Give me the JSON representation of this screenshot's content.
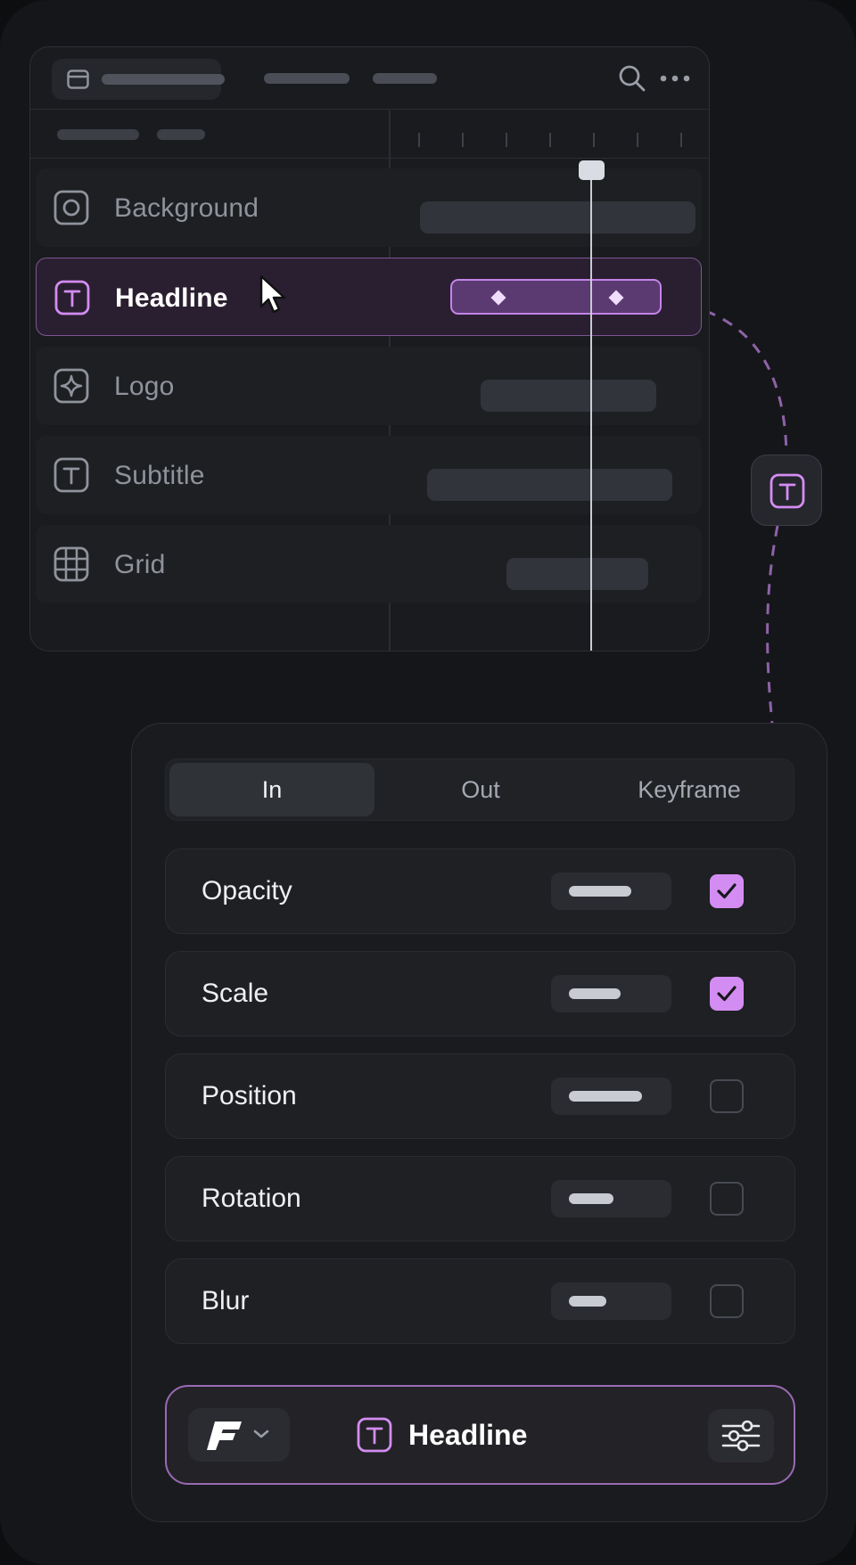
{
  "timeline": {
    "layers": [
      {
        "label": "Background",
        "icon": "circle-square-icon",
        "selected": false
      },
      {
        "label": "Headline",
        "icon": "text-icon",
        "selected": true
      },
      {
        "label": "Logo",
        "icon": "sparkle-icon",
        "selected": false
      },
      {
        "label": "Subtitle",
        "icon": "text-icon",
        "selected": false
      },
      {
        "label": "Grid",
        "icon": "grid-icon",
        "selected": false
      }
    ]
  },
  "animation": {
    "tabs": [
      {
        "label": "In",
        "active": true
      },
      {
        "label": "Out",
        "active": false
      },
      {
        "label": "Keyframe",
        "active": false
      }
    ],
    "properties": [
      {
        "label": "Opacity",
        "checked": true
      },
      {
        "label": "Scale",
        "checked": true
      },
      {
        "label": "Position",
        "checked": false
      },
      {
        "label": "Rotation",
        "checked": false
      },
      {
        "label": "Blur",
        "checked": false
      }
    ],
    "footer": {
      "layer_name": "Headline",
      "layer_icon": "text-icon",
      "font_icon": "font-f-icon",
      "settings_icon": "sliders-icon"
    }
  },
  "colors": {
    "accent": "#d38df2",
    "accent_border": "#9a6ab5",
    "background": "#151619",
    "panel": "#1a1b1f"
  }
}
